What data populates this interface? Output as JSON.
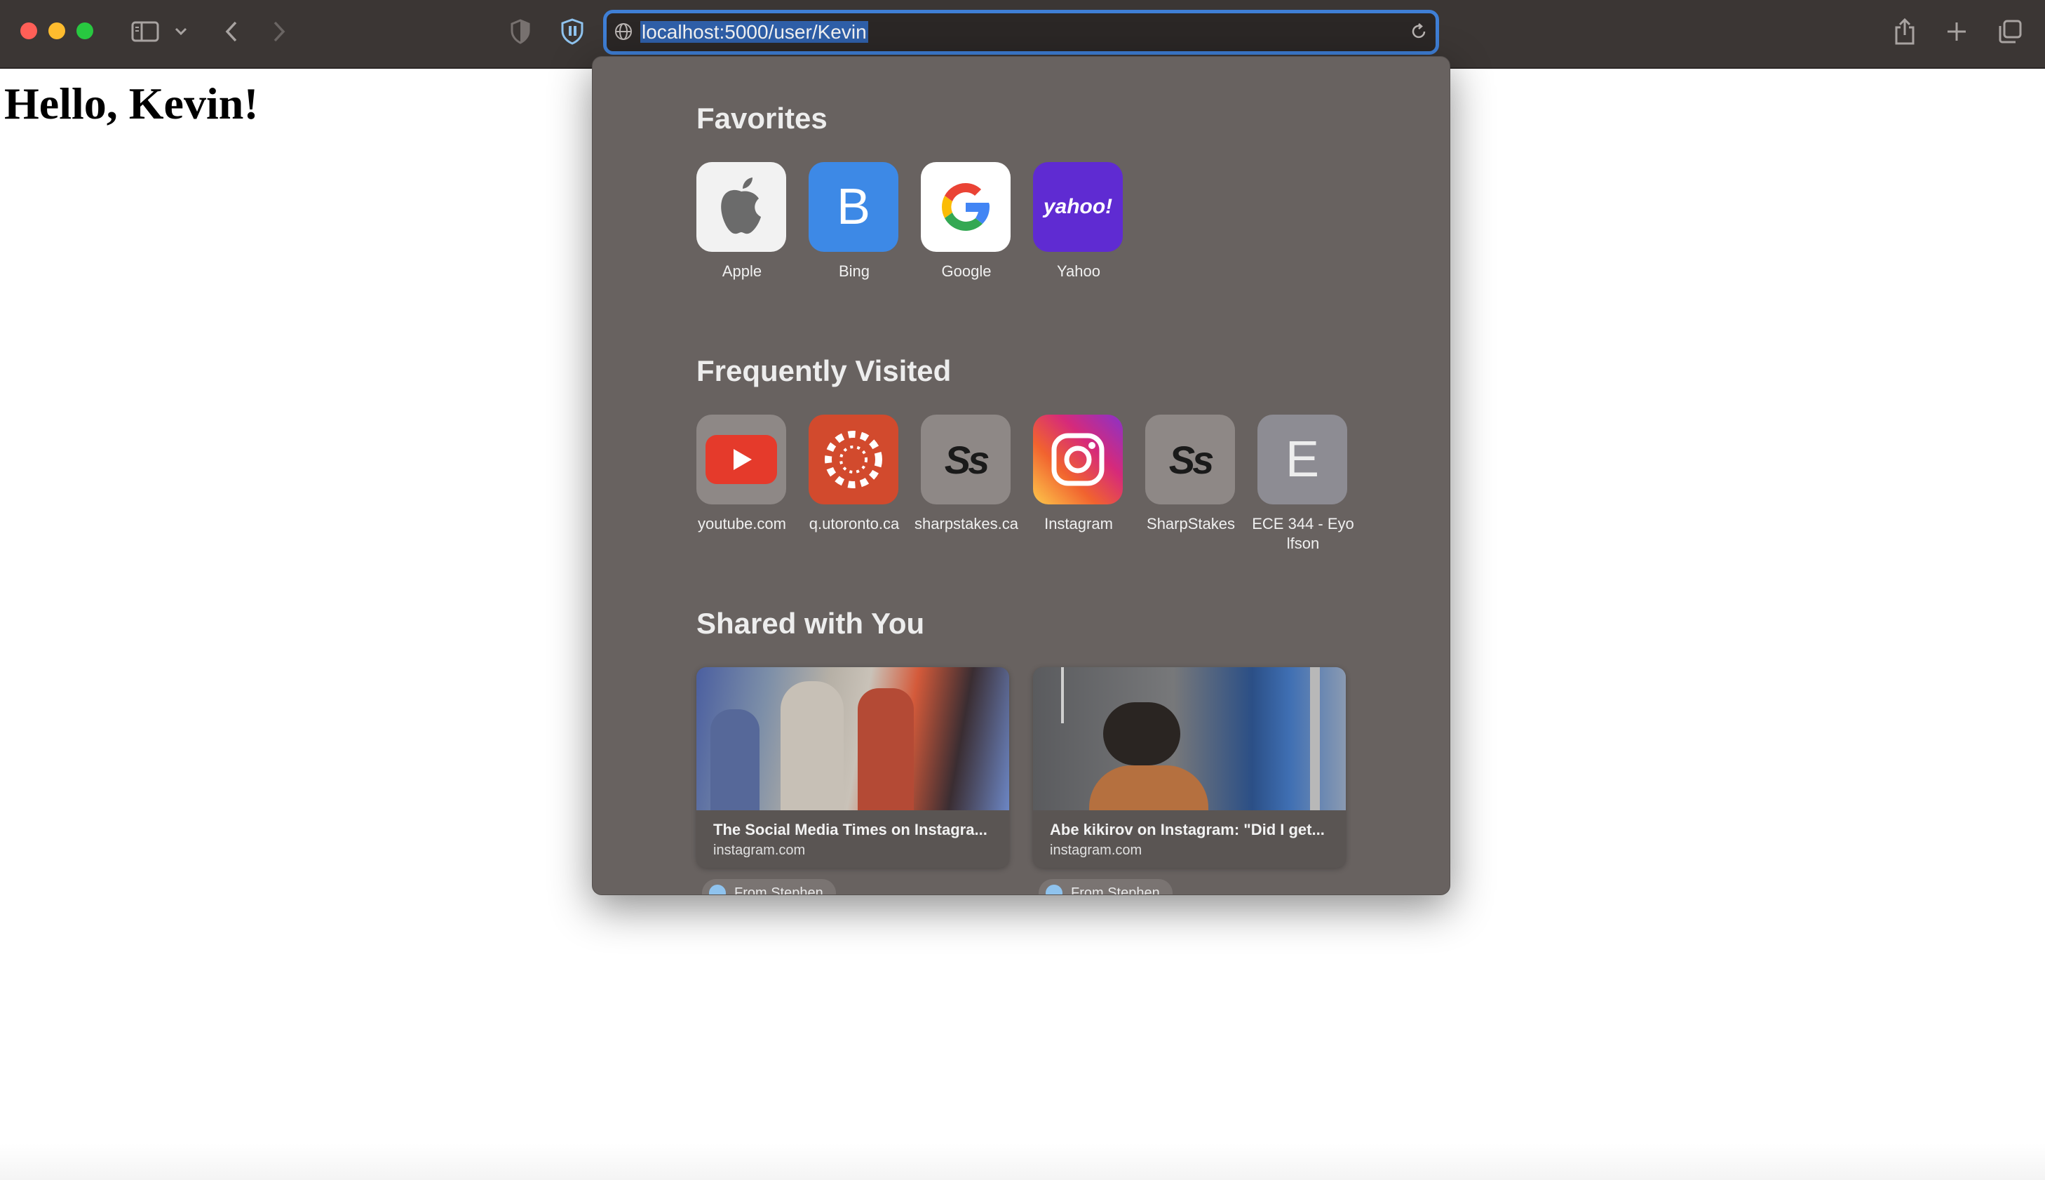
{
  "toolbar": {
    "url": "localhost:5000/user/Kevin"
  },
  "page": {
    "heading": "Hello, Kevin!"
  },
  "popover": {
    "favorites_title": "Favorites",
    "favorites": [
      {
        "label": "Apple",
        "icon": "apple-icon"
      },
      {
        "label": "Bing",
        "icon_letter": "B"
      },
      {
        "label": "Google",
        "icon": "google-icon"
      },
      {
        "label": "Yahoo",
        "icon_text": "yahoo!"
      }
    ],
    "frequent_title": "Frequently Visited",
    "frequent": [
      {
        "label": "youtube.com",
        "icon": "youtube-icon"
      },
      {
        "label": "q.utoronto.ca",
        "icon": "canvas-icon"
      },
      {
        "label": "sharpstakes.ca",
        "icon_text": "Ss"
      },
      {
        "label": "Instagram",
        "icon": "instagram-icon"
      },
      {
        "label": "SharpStakes",
        "icon_text": "Ss"
      },
      {
        "label": "ECE 344 - Eyolfson",
        "icon_letter": "E"
      }
    ],
    "shared_title": "Shared with You",
    "shared": [
      {
        "title": "The Social Media Times on Instagra...",
        "domain": "instagram.com",
        "from": "From Stephen"
      },
      {
        "title": "Abe kikirov on Instagram: \"Did I get...",
        "domain": "instagram.com",
        "from": "From Stephen"
      }
    ]
  },
  "colors": {
    "accent": "#3f7fd6",
    "toolbar_bg": "#3b3634",
    "popover_bg": "#686260",
    "bing": "#3d89e6",
    "yahoo": "#5f2bd2",
    "youtube": "#e53a2b",
    "canvas": "#d24a2d"
  }
}
